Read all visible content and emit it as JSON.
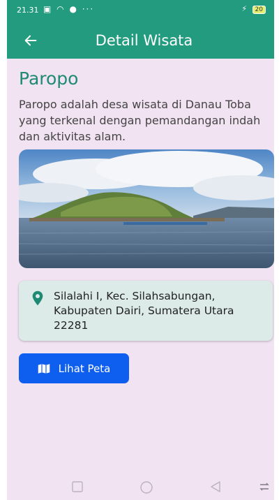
{
  "status_bar": {
    "time": "21.31",
    "battery": "20"
  },
  "app_bar": {
    "title": "Detail Wisata",
    "back_icon": "arrow-left-icon"
  },
  "place": {
    "name": "Paropo",
    "description": "Paropo adalah desa wisata di Danau Toba yang terkenal dengan pemandangan indah dan aktivitas alam.",
    "address": "Silalahi I, Kec. Silahsabungan, Kabupaten Dairi, Sumatera Utara 22281",
    "address_icon": "location-pin-icon"
  },
  "actions": {
    "map_button_label": "Lihat Peta",
    "map_icon": "map-icon"
  },
  "colors": {
    "primary": "#229b7f",
    "background": "#f1e3f2",
    "button": "#0e5ff0",
    "address_card": "#dcebe8"
  }
}
